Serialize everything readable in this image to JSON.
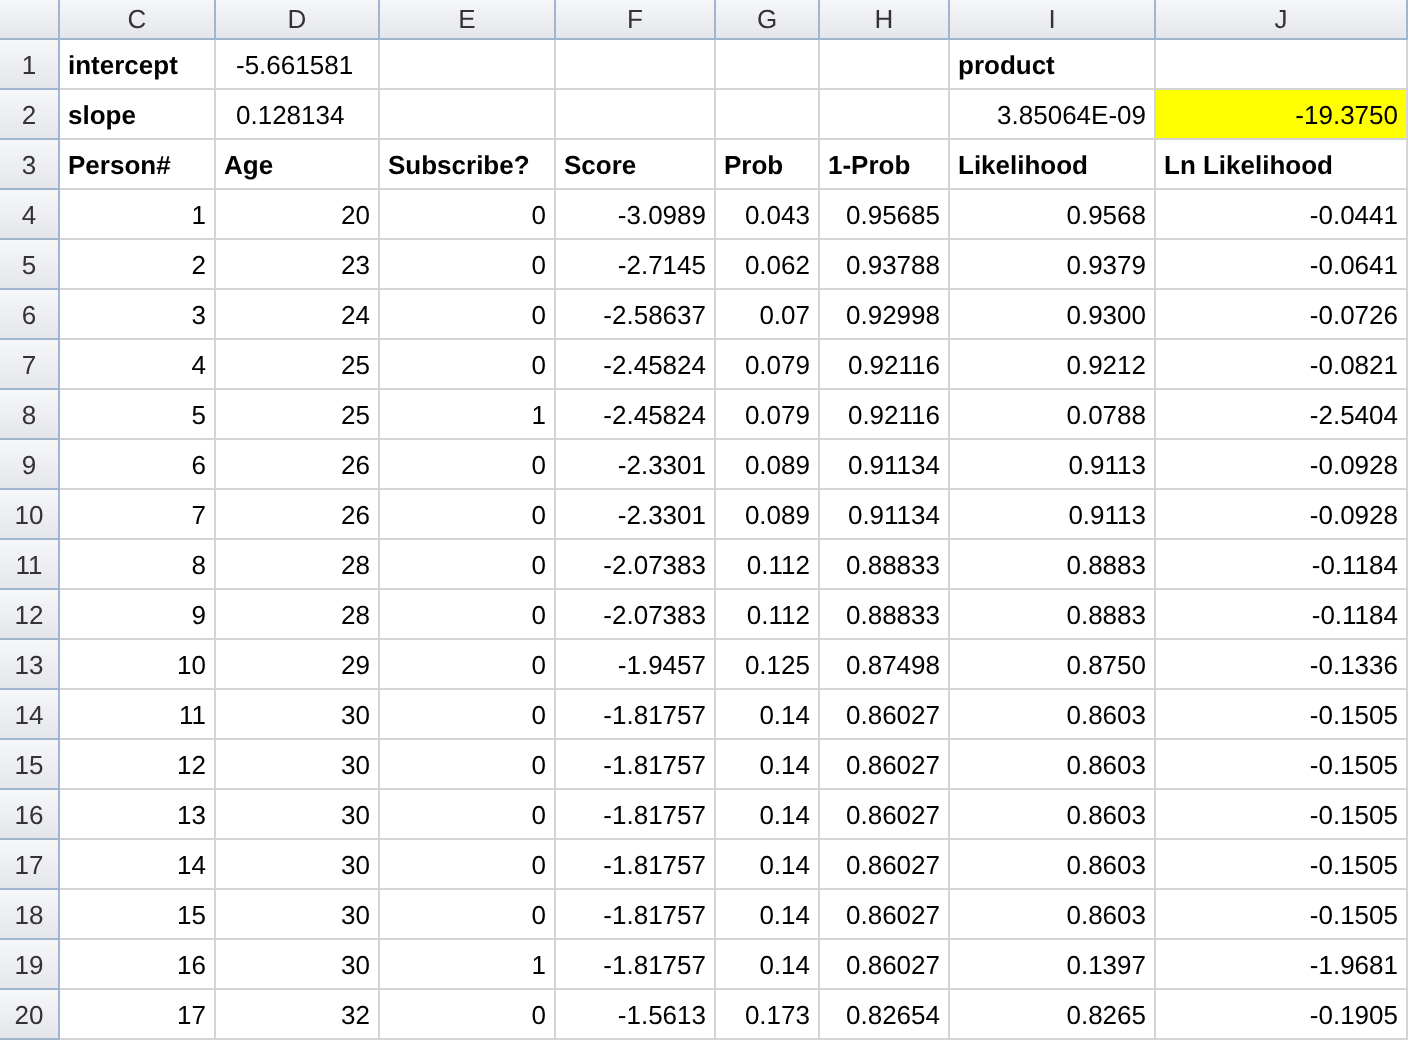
{
  "columns": [
    "C",
    "D",
    "E",
    "F",
    "G",
    "H",
    "I",
    "J"
  ],
  "top_rows": [
    {
      "row": "1",
      "cells": [
        {
          "text": "intercept",
          "kind": "label",
          "highlighted": false
        },
        {
          "text": "-5.661581",
          "kind": "value",
          "highlighted": false
        },
        {
          "kind": "empty",
          "highlighted": false
        },
        {
          "kind": "empty",
          "highlighted": false
        },
        {
          "kind": "empty",
          "highlighted": false
        },
        {
          "kind": "empty",
          "highlighted": false
        },
        {
          "text": "product",
          "kind": "label",
          "highlighted": false
        },
        {
          "kind": "empty",
          "highlighted": false
        }
      ]
    },
    {
      "row": "2",
      "cells": [
        {
          "text": "slope",
          "kind": "label",
          "highlighted": false
        },
        {
          "text": "0.128134",
          "kind": "value",
          "highlighted": false
        },
        {
          "kind": "empty",
          "highlighted": false
        },
        {
          "kind": "empty",
          "highlighted": false
        },
        {
          "kind": "empty",
          "highlighted": false
        },
        {
          "kind": "empty",
          "highlighted": false
        },
        {
          "text": "3.85064E-09",
          "kind": "number",
          "highlighted": false
        },
        {
          "text": "-19.3750",
          "kind": "number",
          "highlighted": true
        }
      ]
    },
    {
      "row": "3",
      "cells": [
        {
          "text": "Person#",
          "kind": "label",
          "highlighted": false
        },
        {
          "text": "Age",
          "kind": "label",
          "highlighted": false
        },
        {
          "text": "Subscribe?",
          "kind": "label",
          "highlighted": false
        },
        {
          "text": "Score",
          "kind": "label",
          "highlighted": false
        },
        {
          "text": "Prob",
          "kind": "label",
          "highlighted": false
        },
        {
          "text": "1-Prob",
          "kind": "label",
          "highlighted": false
        },
        {
          "text": "Likelihood",
          "kind": "label",
          "highlighted": false
        },
        {
          "text": "Ln Likelihood",
          "kind": "label",
          "highlighted": false
        }
      ]
    }
  ],
  "data_rows": [
    {
      "row": "4",
      "values": [
        "1",
        "20",
        "0",
        "-3.0989",
        "0.043",
        "0.95685",
        "0.9568",
        "-0.0441"
      ]
    },
    {
      "row": "5",
      "values": [
        "2",
        "23",
        "0",
        "-2.7145",
        "0.062",
        "0.93788",
        "0.9379",
        "-0.0641"
      ]
    },
    {
      "row": "6",
      "values": [
        "3",
        "24",
        "0",
        "-2.58637",
        "0.07",
        "0.92998",
        "0.9300",
        "-0.0726"
      ]
    },
    {
      "row": "7",
      "values": [
        "4",
        "25",
        "0",
        "-2.45824",
        "0.079",
        "0.92116",
        "0.9212",
        "-0.0821"
      ]
    },
    {
      "row": "8",
      "values": [
        "5",
        "25",
        "1",
        "-2.45824",
        "0.079",
        "0.92116",
        "0.0788",
        "-2.5404"
      ]
    },
    {
      "row": "9",
      "values": [
        "6",
        "26",
        "0",
        "-2.3301",
        "0.089",
        "0.91134",
        "0.9113",
        "-0.0928"
      ]
    },
    {
      "row": "10",
      "values": [
        "7",
        "26",
        "0",
        "-2.3301",
        "0.089",
        "0.91134",
        "0.9113",
        "-0.0928"
      ]
    },
    {
      "row": "11",
      "values": [
        "8",
        "28",
        "0",
        "-2.07383",
        "0.112",
        "0.88833",
        "0.8883",
        "-0.1184"
      ]
    },
    {
      "row": "12",
      "values": [
        "9",
        "28",
        "0",
        "-2.07383",
        "0.112",
        "0.88833",
        "0.8883",
        "-0.1184"
      ]
    },
    {
      "row": "13",
      "values": [
        "10",
        "29",
        "0",
        "-1.9457",
        "0.125",
        "0.87498",
        "0.8750",
        "-0.1336"
      ]
    },
    {
      "row": "14",
      "values": [
        "11",
        "30",
        "0",
        "-1.81757",
        "0.14",
        "0.86027",
        "0.8603",
        "-0.1505"
      ]
    },
    {
      "row": "15",
      "values": [
        "12",
        "30",
        "0",
        "-1.81757",
        "0.14",
        "0.86027",
        "0.8603",
        "-0.1505"
      ]
    },
    {
      "row": "16",
      "values": [
        "13",
        "30",
        "0",
        "-1.81757",
        "0.14",
        "0.86027",
        "0.8603",
        "-0.1505"
      ]
    },
    {
      "row": "17",
      "values": [
        "14",
        "30",
        "0",
        "-1.81757",
        "0.14",
        "0.86027",
        "0.8603",
        "-0.1505"
      ]
    },
    {
      "row": "18",
      "values": [
        "15",
        "30",
        "0",
        "-1.81757",
        "0.14",
        "0.86027",
        "0.8603",
        "-0.1505"
      ]
    },
    {
      "row": "19",
      "values": [
        "16",
        "30",
        "1",
        "-1.81757",
        "0.14",
        "0.86027",
        "0.1397",
        "-1.9681"
      ]
    },
    {
      "row": "20",
      "values": [
        "17",
        "32",
        "0",
        "-1.5613",
        "0.173",
        "0.82654",
        "0.8265",
        "-0.1905"
      ]
    }
  ]
}
